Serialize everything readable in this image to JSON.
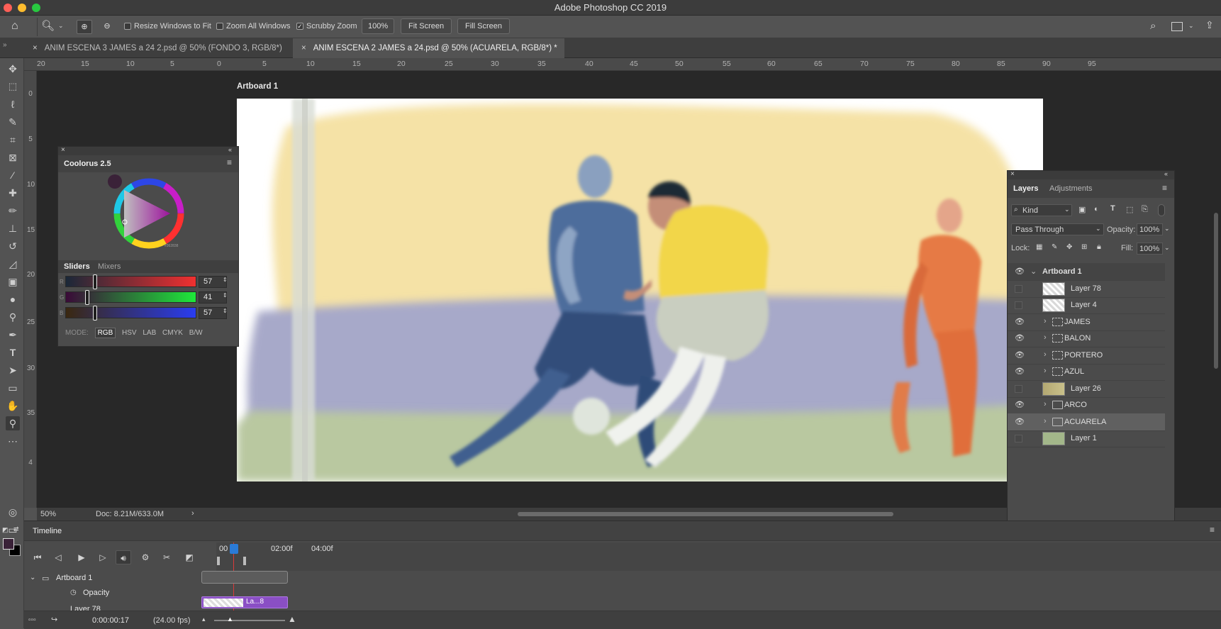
{
  "window": {
    "title": "Adobe Photoshop CC 2019"
  },
  "options_bar": {
    "resize_windows": "Resize Windows to Fit",
    "zoom_all": "Zoom All Windows",
    "scrubby_zoom": "Scrubby Zoom",
    "zoom_value": "100%",
    "fit_screen": "Fit Screen",
    "fill_screen": "Fill Screen"
  },
  "tabs": [
    {
      "label": "ANIM ESCENA 3 JAMES a 24 2.psd @ 50% (FONDO 3, RGB/8*)"
    },
    {
      "label": "ANIM ESCENA 2 JAMES a 24.psd @ 50% (ACUARELA, RGB/8*) *"
    }
  ],
  "ruler": {
    "h": [
      "20",
      "15",
      "10",
      "5",
      "0",
      "5",
      "10",
      "15",
      "20",
      "25",
      "30",
      "35",
      "40",
      "45",
      "50",
      "55",
      "60",
      "65",
      "70",
      "75",
      "80",
      "85",
      "90",
      "95"
    ],
    "v": [
      "0",
      "5",
      "10",
      "15",
      "20",
      "25",
      "30",
      "35",
      "4"
    ]
  },
  "canvas": {
    "artboard_label": "Artboard 1"
  },
  "status": {
    "zoom": "50%",
    "doc": "Doc: 8.21M/633.0M"
  },
  "colorpanel": {
    "title": "Coolorus 2.5",
    "small_value": "#362838",
    "tabs": [
      "Sliders",
      "Mixers"
    ],
    "sliders": [
      {
        "channel": "R",
        "value": "57",
        "pos": 0.22
      },
      {
        "channel": "G",
        "value": "41",
        "pos": 0.16
      },
      {
        "channel": "B",
        "value": "57",
        "pos": 0.22
      }
    ],
    "mode_label": "MODE:",
    "modes": [
      "RGB",
      "HSV",
      "LAB",
      "CMYK",
      "B/W"
    ]
  },
  "layers": {
    "tabs": [
      "Layers",
      "Adjustments"
    ],
    "filter": "Kind",
    "blend_mode": "Pass Through",
    "opacity_label": "Opacity:",
    "opacity_value": "100%",
    "lock_label": "Lock:",
    "fill_label": "Fill:",
    "fill_value": "100%",
    "items": [
      {
        "name": "Artboard 1",
        "visible": true,
        "kind": "artboard"
      },
      {
        "name": "Layer 78",
        "visible": false,
        "kind": "pixel"
      },
      {
        "name": "Layer 4",
        "visible": false,
        "kind": "pixel"
      },
      {
        "name": "JAMES",
        "visible": true,
        "kind": "video-group"
      },
      {
        "name": "BALON",
        "visible": true,
        "kind": "video-group"
      },
      {
        "name": "PORTERO",
        "visible": true,
        "kind": "video-group"
      },
      {
        "name": "AZUL",
        "visible": true,
        "kind": "video-group"
      },
      {
        "name": "Layer 26",
        "visible": false,
        "kind": "smart"
      },
      {
        "name": "ARCO",
        "visible": true,
        "kind": "folder"
      },
      {
        "name": "ACUARELA",
        "visible": true,
        "kind": "folder"
      },
      {
        "name": "Layer 1",
        "visible": false,
        "kind": "pixel"
      }
    ]
  },
  "timeline": {
    "title": "Timeline",
    "time_marks": [
      "00",
      "02:00f",
      "04:00f"
    ],
    "tracks": [
      "Artboard 1",
      "Opacity",
      "Layer 78"
    ],
    "clip_label": "La...8",
    "current_time": "0:00:00:17",
    "fps": "(24.00 fps)"
  },
  "colors": {
    "foreground": "#3a2238",
    "background": "#000000",
    "accent": "#8a4fc4"
  }
}
